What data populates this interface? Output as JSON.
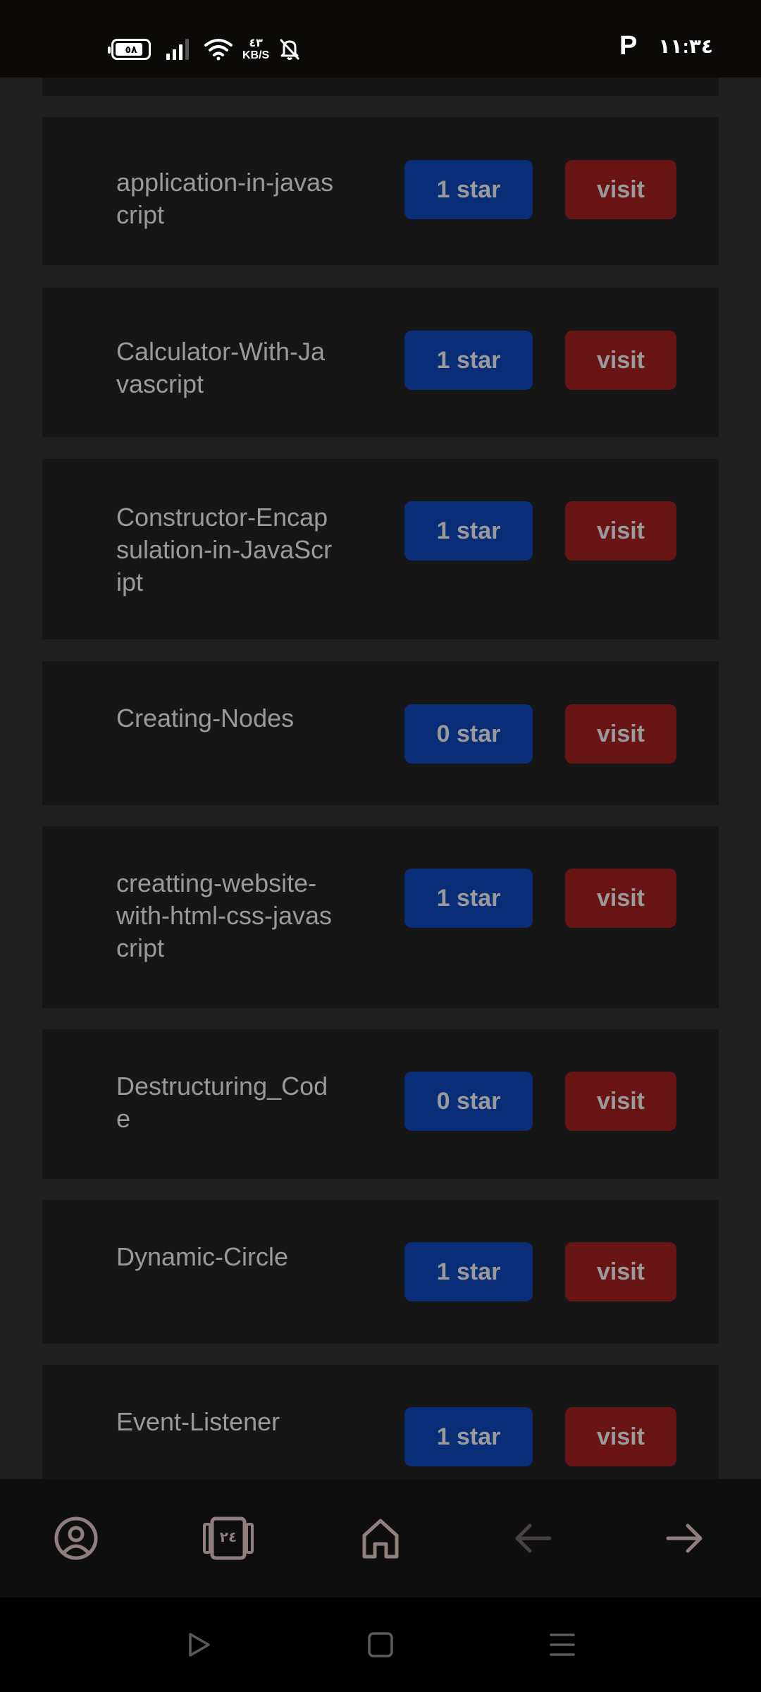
{
  "status_bar": {
    "battery_level": "٥٨",
    "net_speed_value": "٤٣",
    "net_speed_unit": "KB/S",
    "carrier_icon_label": "P",
    "time": "١١:٣٤"
  },
  "repos": [
    {
      "name": "application-in-javascript",
      "stars": "1 star",
      "visit": "visit"
    },
    {
      "name": "Calculator-With-Javascript",
      "stars": "1 star",
      "visit": "visit"
    },
    {
      "name": "Constructor-Encapsulation-in-JavaScript",
      "stars": "1 star",
      "visit": "visit"
    },
    {
      "name": "Creating-Nodes",
      "stars": "0 star",
      "visit": "visit"
    },
    {
      "name": "creatting-website-with-html-css-javascript",
      "stars": "1 star",
      "visit": "visit"
    },
    {
      "name": "Destructuring_Code",
      "stars": "0 star",
      "visit": "visit"
    },
    {
      "name": "Dynamic-Circle",
      "stars": "1 star",
      "visit": "visit"
    },
    {
      "name": "Event-Listener",
      "stars": "1 star",
      "visit": "visit"
    }
  ],
  "app_nav": {
    "tab_count": "٢٤",
    "icons": [
      "profile-icon",
      "tabs-icon",
      "home-icon",
      "back-arrow-icon",
      "forward-arrow-icon"
    ]
  },
  "system_nav": {
    "icons": [
      "play-icon",
      "square-icon",
      "menu-icon"
    ]
  },
  "colors": {
    "star_button": "#0a2d78",
    "visit_button": "#6a1515",
    "card": "#161616",
    "text": "#9a9a9a"
  }
}
